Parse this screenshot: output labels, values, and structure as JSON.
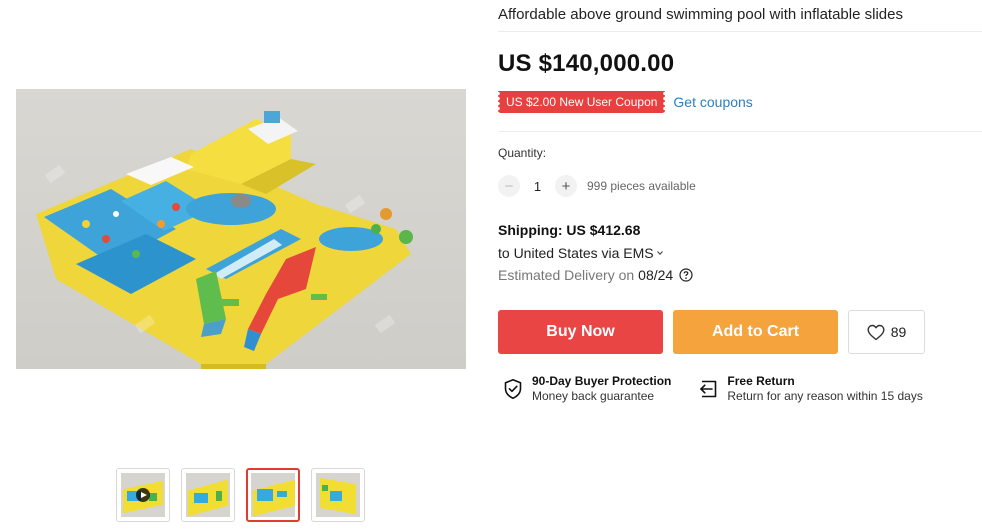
{
  "product": {
    "title": "Affordable above ground swimming pool with inflatable slides",
    "price": "US $140,000.00"
  },
  "coupon": {
    "badge": "US $2.00 New User Coupon",
    "link": "Get coupons",
    "badge_color": "#e8403f",
    "link_color": "#2b7fc1"
  },
  "quantity": {
    "label": "Quantity:",
    "minus_symbol": "−",
    "value": "1",
    "plus_symbol": "+",
    "available": "999 pieces available"
  },
  "shipping": {
    "title": "Shipping: US $412.68",
    "destination": "to United States via EMS",
    "delivery_label": "Estimated Delivery on",
    "delivery_date": "08/24"
  },
  "actions": {
    "buy_now": "Buy Now",
    "add_to_cart": "Add to Cart",
    "wishlist_count": "89",
    "buy_color": "#ea4545",
    "cart_color": "#f5a33c"
  },
  "guarantees": [
    {
      "icon": "shield-check-icon",
      "title": "90-Day Buyer Protection",
      "subtitle": "Money back guarantee"
    },
    {
      "icon": "return-arrow-icon",
      "title": "Free Return",
      "subtitle": "Return for any reason within 15 days"
    }
  ],
  "gallery": {
    "thumbnail_count": 4,
    "selected_index": 2,
    "first_is_video": true
  }
}
